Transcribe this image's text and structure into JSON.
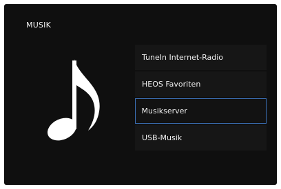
{
  "screen": {
    "title": "MUSIK"
  },
  "icon": {
    "name": "music-note-icon",
    "color": "#ffffff"
  },
  "menu": {
    "selected_index": 2,
    "selected_border_color": "#3b6fb5",
    "items": [
      {
        "label": "TuneIn Internet-Radio"
      },
      {
        "label": "HEOS Favoriten"
      },
      {
        "label": "Musikserver"
      },
      {
        "label": "USB-Musik"
      }
    ]
  }
}
